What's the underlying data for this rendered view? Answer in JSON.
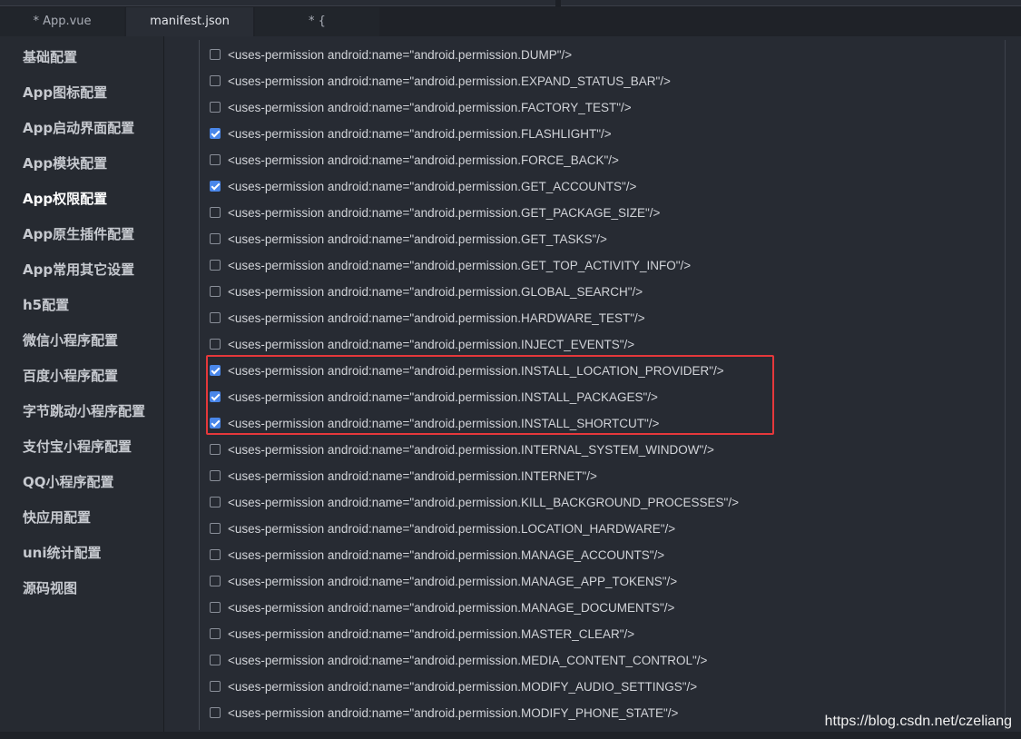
{
  "tabs": [
    {
      "label": "* App.vue",
      "active": false
    },
    {
      "label": "manifest.json",
      "active": true
    },
    {
      "label": "* {",
      "active": false
    }
  ],
  "sidebar": {
    "items": [
      {
        "label": "基础配置",
        "active": false
      },
      {
        "label": "App图标配置",
        "active": false
      },
      {
        "label": "App启动界面配置",
        "active": false
      },
      {
        "label": "App模块配置",
        "active": false
      },
      {
        "label": "App权限配置",
        "active": true
      },
      {
        "label": "App原生插件配置",
        "active": false
      },
      {
        "label": "App常用其它设置",
        "active": false
      },
      {
        "label": "h5配置",
        "active": false
      },
      {
        "label": "微信小程序配置",
        "active": false
      },
      {
        "label": "百度小程序配置",
        "active": false
      },
      {
        "label": "字节跳动小程序配置",
        "active": false
      },
      {
        "label": "支付宝小程序配置",
        "active": false
      },
      {
        "label": "QQ小程序配置",
        "active": false
      },
      {
        "label": "快应用配置",
        "active": false
      },
      {
        "label": "uni统计配置",
        "active": false
      },
      {
        "label": "源码视图",
        "active": false
      }
    ]
  },
  "permissions": [
    {
      "text": "<uses-permission android:name=\"android.permission.DUMP\"/>",
      "checked": false
    },
    {
      "text": "<uses-permission android:name=\"android.permission.EXPAND_STATUS_BAR\"/>",
      "checked": false
    },
    {
      "text": "<uses-permission android:name=\"android.permission.FACTORY_TEST\"/>",
      "checked": false
    },
    {
      "text": "<uses-permission android:name=\"android.permission.FLASHLIGHT\"/>",
      "checked": true
    },
    {
      "text": "<uses-permission android:name=\"android.permission.FORCE_BACK\"/>",
      "checked": false
    },
    {
      "text": "<uses-permission android:name=\"android.permission.GET_ACCOUNTS\"/>",
      "checked": true
    },
    {
      "text": "<uses-permission android:name=\"android.permission.GET_PACKAGE_SIZE\"/>",
      "checked": false
    },
    {
      "text": "<uses-permission android:name=\"android.permission.GET_TASKS\"/>",
      "checked": false
    },
    {
      "text": "<uses-permission android:name=\"android.permission.GET_TOP_ACTIVITY_INFO\"/>",
      "checked": false
    },
    {
      "text": "<uses-permission android:name=\"android.permission.GLOBAL_SEARCH\"/>",
      "checked": false
    },
    {
      "text": "<uses-permission android:name=\"android.permission.HARDWARE_TEST\"/>",
      "checked": false
    },
    {
      "text": "<uses-permission android:name=\"android.permission.INJECT_EVENTS\"/>",
      "checked": false
    },
    {
      "text": "<uses-permission android:name=\"android.permission.INSTALL_LOCATION_PROVIDER\"/>",
      "checked": true
    },
    {
      "text": "<uses-permission android:name=\"android.permission.INSTALL_PACKAGES\"/>",
      "checked": true
    },
    {
      "text": "<uses-permission android:name=\"android.permission.INSTALL_SHORTCUT\"/>",
      "checked": true
    },
    {
      "text": "<uses-permission android:name=\"android.permission.INTERNAL_SYSTEM_WINDOW\"/>",
      "checked": false
    },
    {
      "text": "<uses-permission android:name=\"android.permission.INTERNET\"/>",
      "checked": false
    },
    {
      "text": "<uses-permission android:name=\"android.permission.KILL_BACKGROUND_PROCESSES\"/>",
      "checked": false
    },
    {
      "text": "<uses-permission android:name=\"android.permission.LOCATION_HARDWARE\"/>",
      "checked": false
    },
    {
      "text": "<uses-permission android:name=\"android.permission.MANAGE_ACCOUNTS\"/>",
      "checked": false
    },
    {
      "text": "<uses-permission android:name=\"android.permission.MANAGE_APP_TOKENS\"/>",
      "checked": false
    },
    {
      "text": "<uses-permission android:name=\"android.permission.MANAGE_DOCUMENTS\"/>",
      "checked": false
    },
    {
      "text": "<uses-permission android:name=\"android.permission.MASTER_CLEAR\"/>",
      "checked": false
    },
    {
      "text": "<uses-permission android:name=\"android.permission.MEDIA_CONTENT_CONTROL\"/>",
      "checked": false
    },
    {
      "text": "<uses-permission android:name=\"android.permission.MODIFY_AUDIO_SETTINGS\"/>",
      "checked": false
    },
    {
      "text": "<uses-permission android:name=\"android.permission.MODIFY_PHONE_STATE\"/>",
      "checked": false
    }
  ],
  "watermark": "https://blog.csdn.net/czeliang",
  "colors": {
    "accent": "#4a87ea",
    "highlight_border": "#e5383b",
    "background": "#272b33"
  }
}
